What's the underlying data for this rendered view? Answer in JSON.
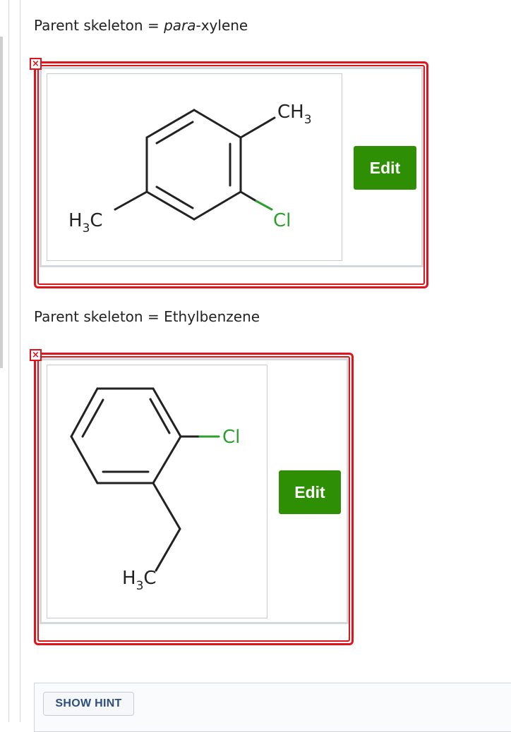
{
  "question1": {
    "caption_prefix": "Parent skeleton = ",
    "caption_emphasis": "para",
    "caption_suffix": "-xylene",
    "edit_label": "Edit",
    "labels": {
      "ch3": "CH",
      "ch3_sub": "3",
      "h3c_h": "H",
      "h3c_sub": "3",
      "h3c_c": "C",
      "cl": "Cl"
    }
  },
  "question2": {
    "caption": "Parent skeleton = Ethylbenzene",
    "edit_label": "Edit",
    "labels": {
      "cl": "Cl",
      "h3c_h": "H",
      "h3c_sub": "3",
      "h3c_c": "C"
    }
  },
  "error_icon_glyph": "×",
  "hint": {
    "label": "SHOW HINT"
  },
  "colors": {
    "error": "#e0141a",
    "edit_button": "#2f8f04",
    "chlorine": "#2ca02c",
    "hint_text": "#2e4f7c"
  }
}
